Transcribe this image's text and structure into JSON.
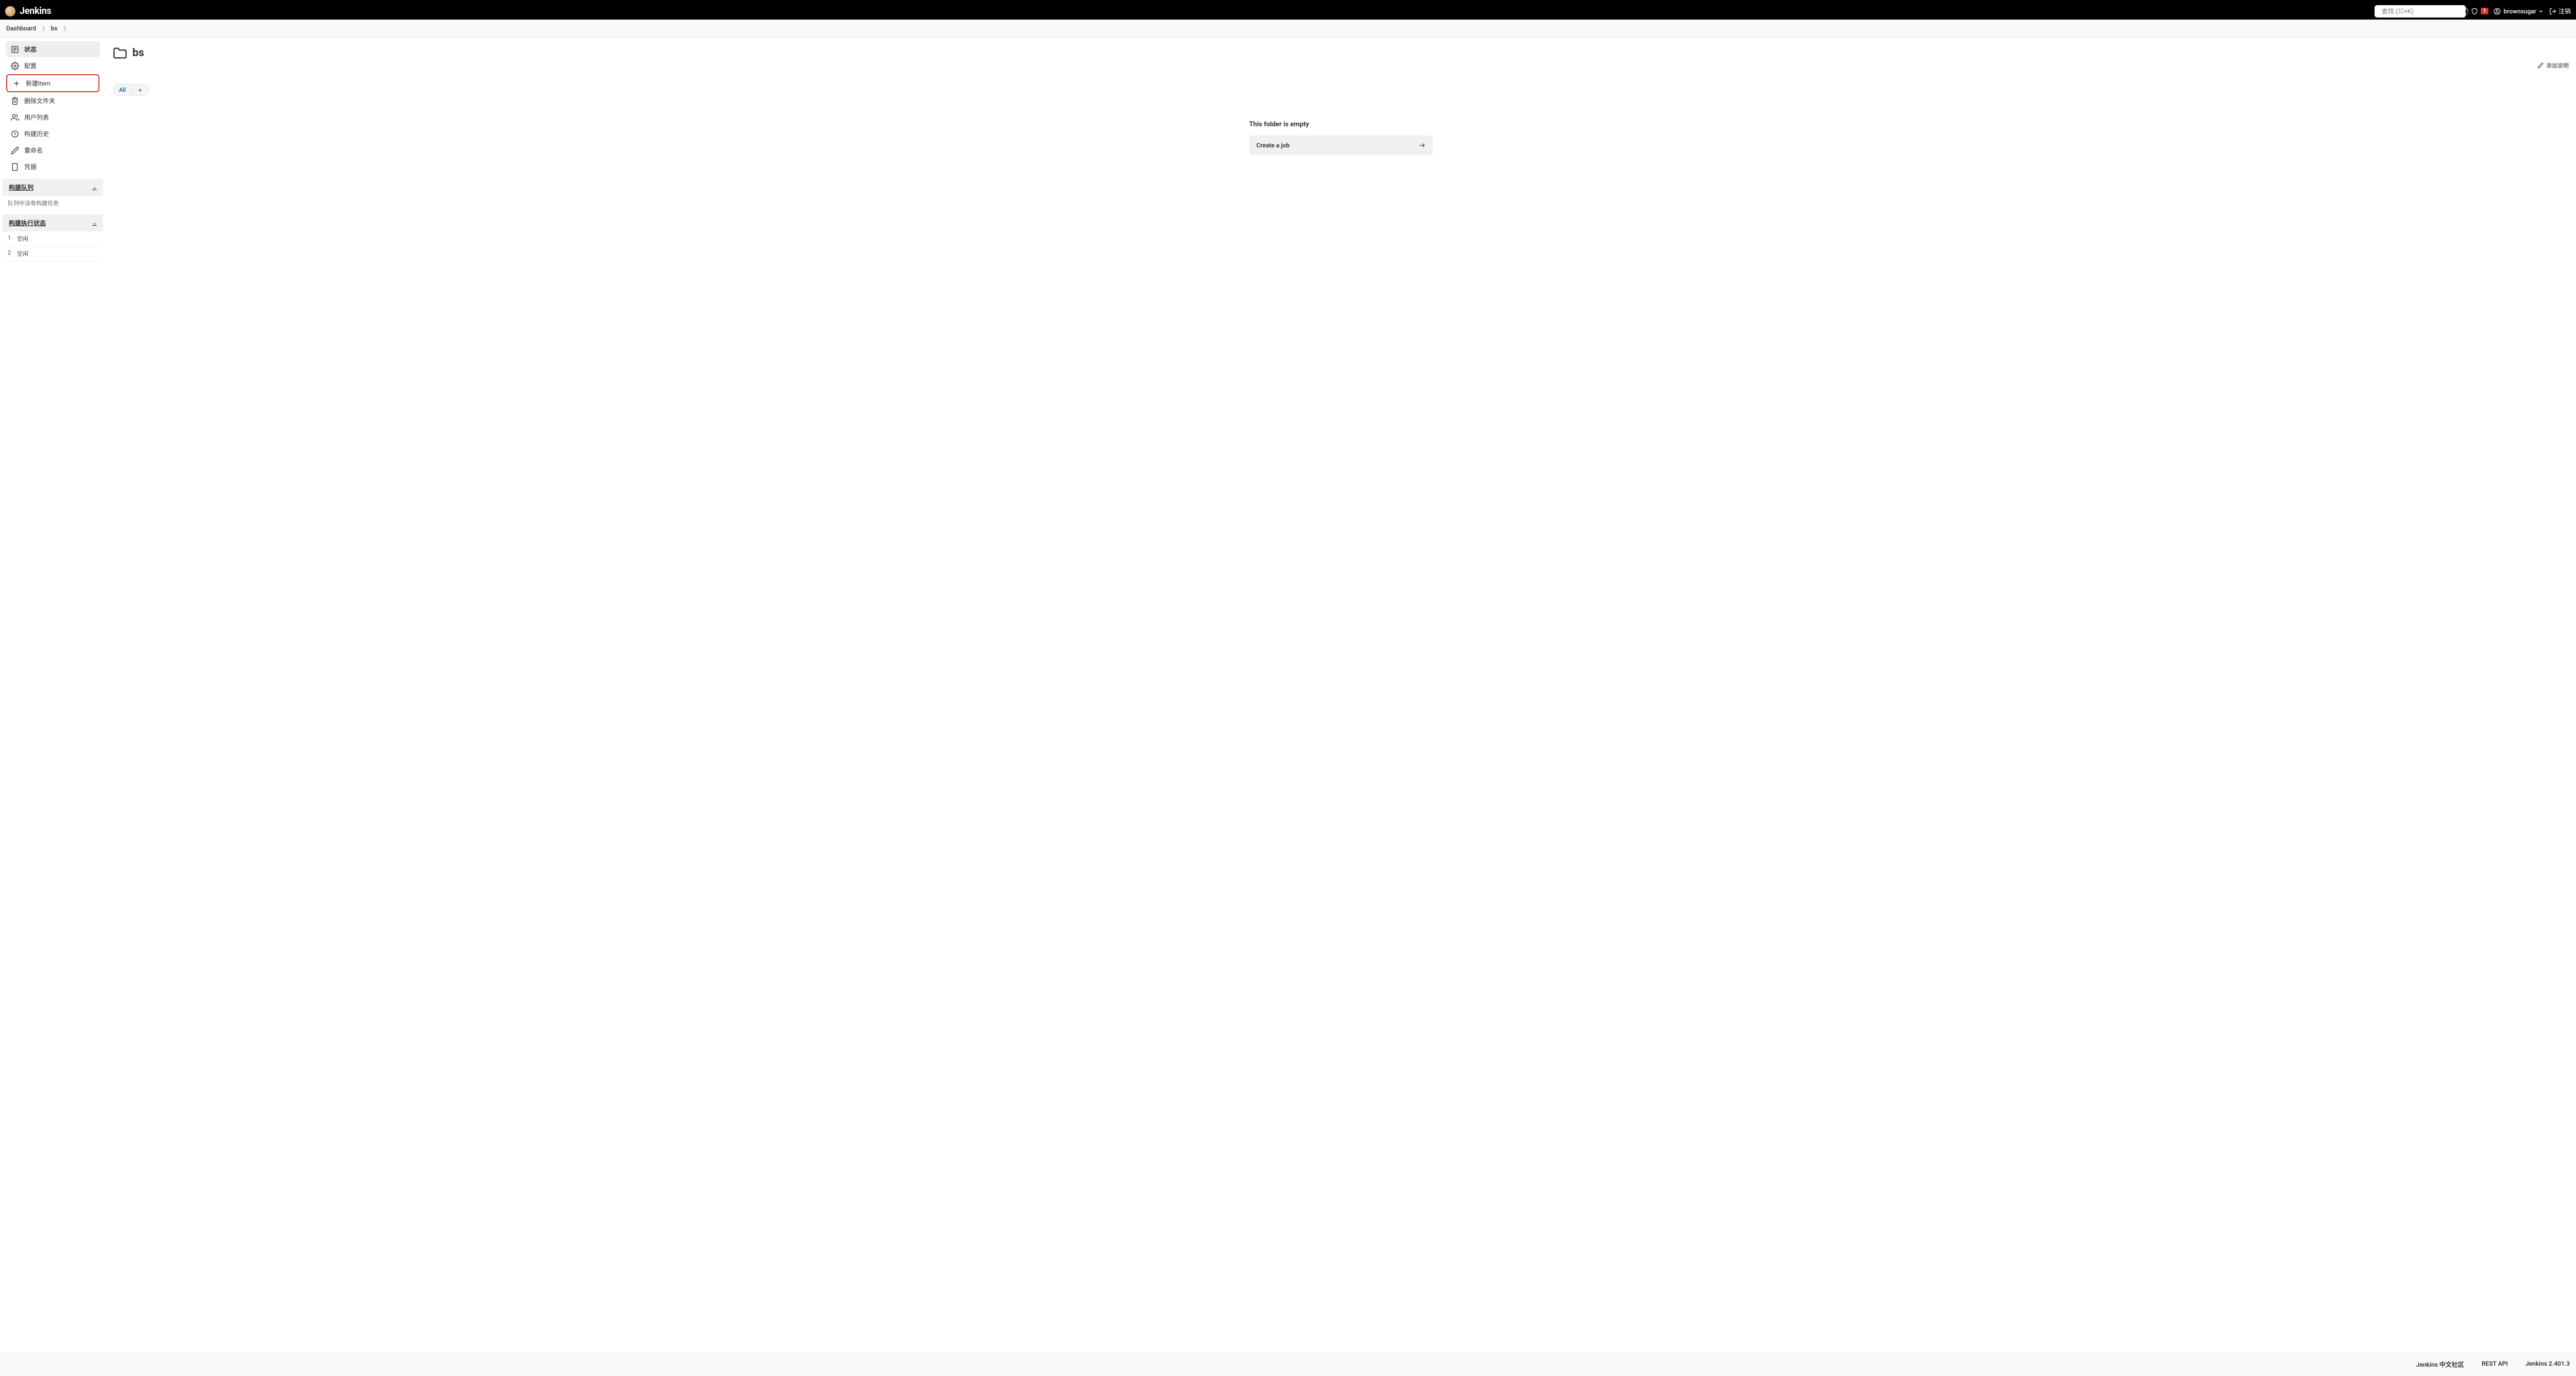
{
  "brand": "Jenkins",
  "search": {
    "placeholder": "查找 (⌘+K)"
  },
  "alerts_count": "1",
  "user": {
    "name": "brownsugar"
  },
  "logout_label": "注销",
  "breadcrumbs": [
    {
      "label": "Dashboard"
    },
    {
      "label": "bs"
    }
  ],
  "sidebar": {
    "items": [
      {
        "label": "状态"
      },
      {
        "label": "配置"
      },
      {
        "label": "新建Item"
      },
      {
        "label": "删除文件夹"
      },
      {
        "label": "用户列表"
      },
      {
        "label": "构建历史"
      },
      {
        "label": "重命名"
      },
      {
        "label": "凭据"
      }
    ],
    "build_queue": {
      "title": "构建队列",
      "empty_msg": "队列中没有构建任务"
    },
    "executors": {
      "title": "构建执行状态",
      "items": [
        {
          "num": "1",
          "status": "空闲"
        },
        {
          "num": "2",
          "status": "空闲"
        }
      ]
    }
  },
  "page": {
    "title": "bs",
    "add_description": "添加说明",
    "tab_all": "All",
    "empty_title": "This folder is empty",
    "create_job": "Create a job"
  },
  "footer": {
    "community": "Jenkins 中文社区",
    "rest_api": "REST API",
    "version": "Jenkins 2.401.3"
  }
}
